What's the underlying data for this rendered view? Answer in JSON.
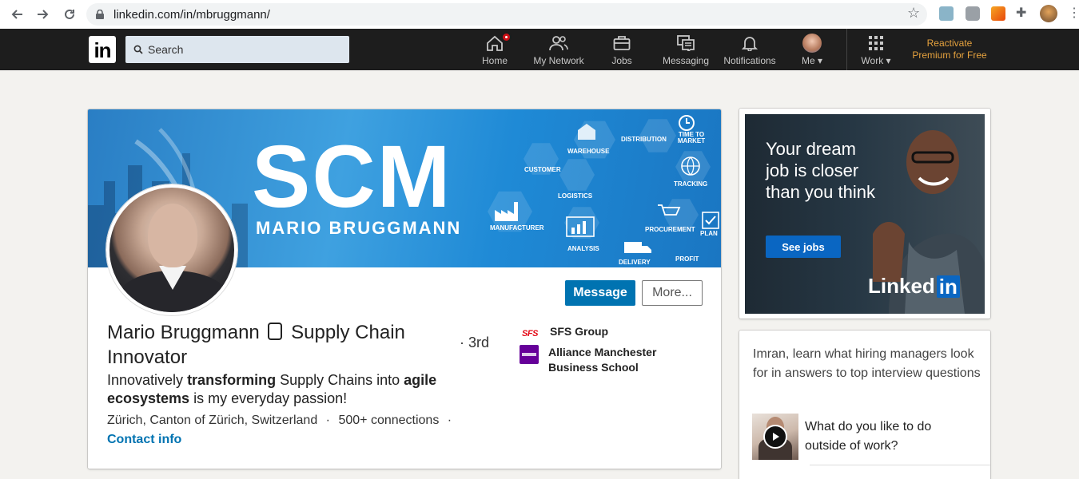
{
  "browser": {
    "url": "linkedin.com/in/mbruggmann/"
  },
  "nav": {
    "search_placeholder": "Search",
    "items": [
      {
        "label": "Home"
      },
      {
        "label": "My Network"
      },
      {
        "label": "Jobs"
      },
      {
        "label": "Messaging"
      },
      {
        "label": "Notifications"
      },
      {
        "label": "Me"
      },
      {
        "label": "Work"
      }
    ],
    "premium_line1": "Reactivate",
    "premium_line2": "Premium for Free"
  },
  "banner": {
    "big_text": "SCM",
    "name": "MARIO BRUGGMANN",
    "tags": [
      "WAREHOUSE",
      "DISTRIBUTION",
      "TIME TO MARKET",
      "CUSTOMER",
      "LOGISTICS",
      "TRACKING",
      "MANUFACTURER",
      "PROCUREMENT",
      "PLAN",
      "ANALYSIS",
      "DELIVERY",
      "PROFIT"
    ]
  },
  "profile": {
    "name_line1": "Mario Bruggmann",
    "name_line2": "Supply Chain",
    "name_line3": "Innovator",
    "degree": "· 3rd",
    "headline_a": "Innovatively ",
    "headline_b": "transforming",
    "headline_c": " Supply Chains into ",
    "headline_d": "agile",
    "headline_e": "ecosystems",
    "headline_f": " is my everyday passion!",
    "location": "Zürich, Canton of Zürich, Switzerland",
    "connections": "500+ connections",
    "contact": "Contact info",
    "message_btn": "Message",
    "more_btn": "More...",
    "orgs": [
      {
        "name": "SFS Group",
        "logo_text": "SFS",
        "color": "#e30613"
      },
      {
        "name": "Alliance Manchester Business School",
        "color": "#660099"
      }
    ]
  },
  "ad": {
    "text": "Your dream job is closer than you think",
    "button": "See jobs",
    "logo_text": "Linked",
    "logo_in": "in"
  },
  "interview": {
    "title": "Imran, learn what hiring managers look for in answers to top interview questions",
    "question": "What do you like to do outside of work?"
  }
}
